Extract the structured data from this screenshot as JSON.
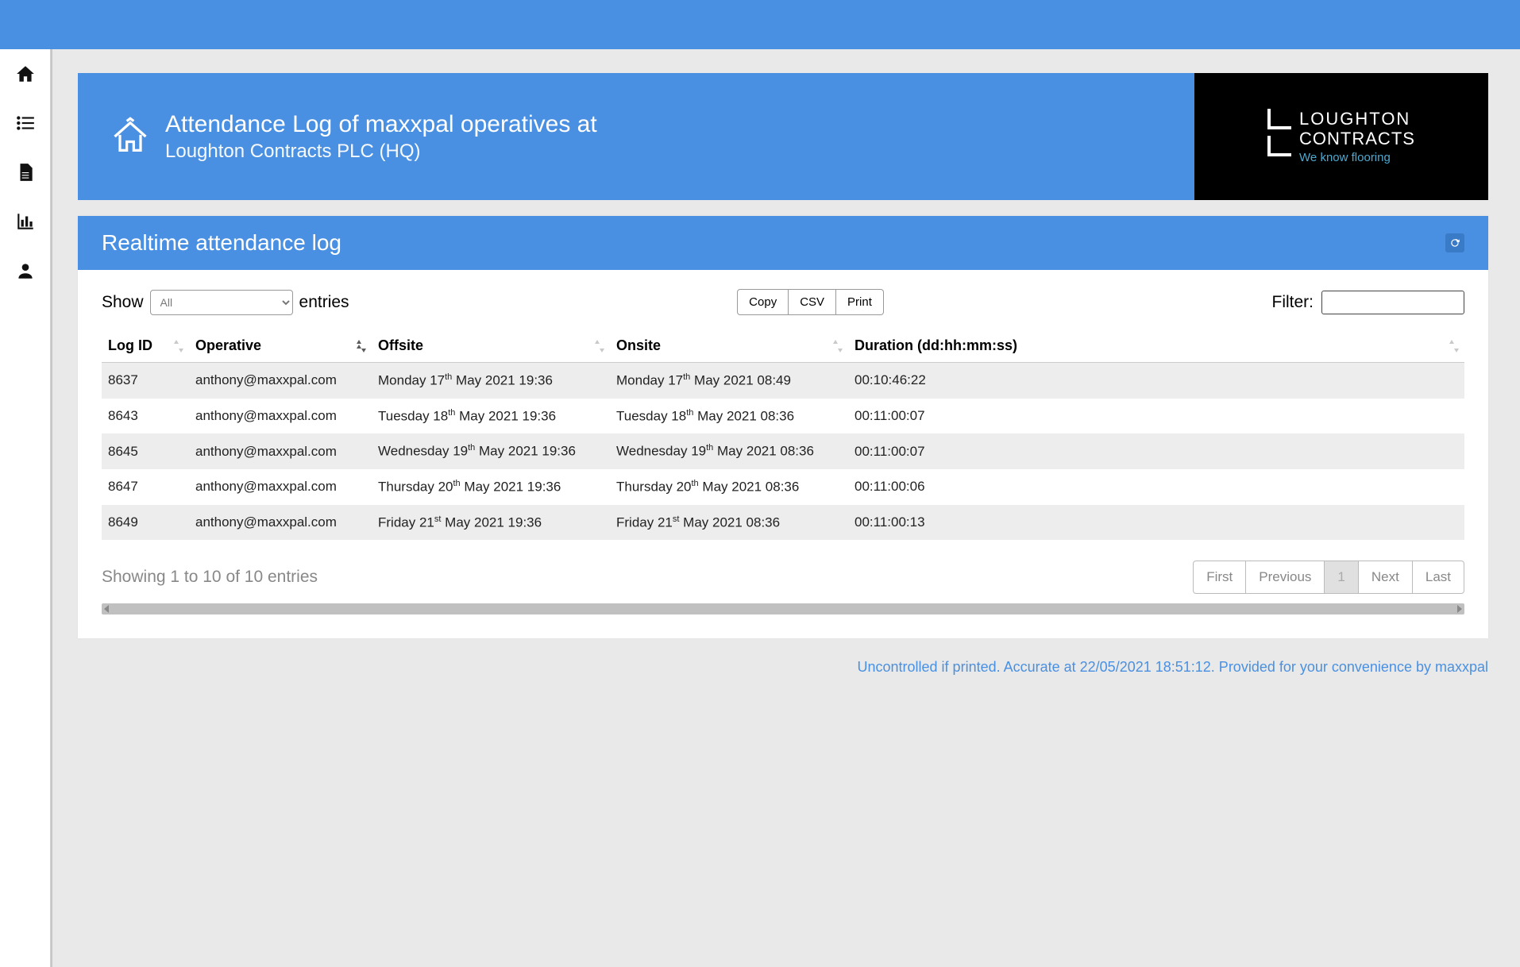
{
  "header": {
    "title": "Attendance Log of maxxpal operatives at",
    "subtitle": "Loughton Contracts PLC (HQ)",
    "logo": {
      "line1": "LOUGHTON",
      "line2": "CONTRACTS",
      "tagline": "We know flooring"
    }
  },
  "panel": {
    "title": "Realtime attendance log",
    "show_label_pre": "Show",
    "show_label_post": "entries",
    "show_value": "All",
    "export": {
      "copy": "Copy",
      "csv": "CSV",
      "print": "Print"
    },
    "filter_label": "Filter:",
    "columns": {
      "log_id": "Log ID",
      "operative": "Operative",
      "offsite": "Offsite",
      "onsite": "Onsite",
      "duration": "Duration (dd:hh:mm:ss)"
    },
    "rows": [
      {
        "id": "8637",
        "op": "anthony@maxxpal.com",
        "off_day": "Monday 17",
        "off_ord": "th",
        "off_rest": " May 2021 19:36",
        "on_day": "Monday 17",
        "on_ord": "th",
        "on_rest": " May 2021 08:49",
        "dur": "00:10:46:22"
      },
      {
        "id": "8643",
        "op": "anthony@maxxpal.com",
        "off_day": "Tuesday 18",
        "off_ord": "th",
        "off_rest": " May 2021 19:36",
        "on_day": "Tuesday 18",
        "on_ord": "th",
        "on_rest": " May 2021 08:36",
        "dur": "00:11:00:07"
      },
      {
        "id": "8645",
        "op": "anthony@maxxpal.com",
        "off_day": "Wednesday 19",
        "off_ord": "th",
        "off_rest": " May 2021 19:36",
        "on_day": "Wednesday 19",
        "on_ord": "th",
        "on_rest": " May 2021 08:36",
        "dur": "00:11:00:07"
      },
      {
        "id": "8647",
        "op": "anthony@maxxpal.com",
        "off_day": "Thursday 20",
        "off_ord": "th",
        "off_rest": " May 2021 19:36",
        "on_day": "Thursday 20",
        "on_ord": "th",
        "on_rest": " May 2021 08:36",
        "dur": "00:11:00:06"
      },
      {
        "id": "8649",
        "op": "anthony@maxxpal.com",
        "off_day": "Friday 21",
        "off_ord": "st",
        "off_rest": " May 2021 19:36",
        "on_day": "Friday 21",
        "on_ord": "st",
        "on_rest": " May 2021 08:36",
        "dur": "00:11:00:13"
      }
    ],
    "showing": "Showing 1 to 10 of 10 entries",
    "pager": {
      "first": "First",
      "prev": "Previous",
      "page": "1",
      "next": "Next",
      "last": "Last"
    }
  },
  "disclaimer": "Uncontrolled if printed. Accurate at 22/05/2021 18:51:12. Provided for your convenience by maxxpal"
}
